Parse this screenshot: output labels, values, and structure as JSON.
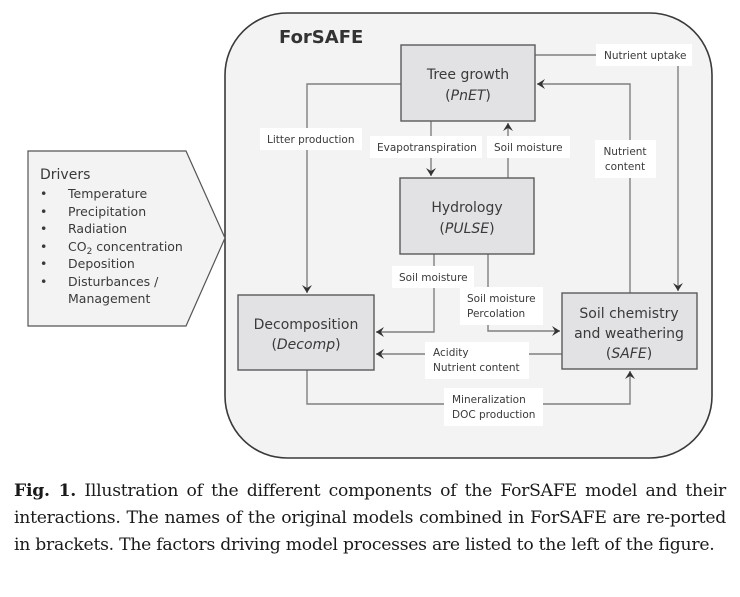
{
  "diagram": {
    "title": "ForSAFE",
    "colors": {
      "outer_fill": "#f3f3f3",
      "outer_stroke": "#3a3a3a",
      "box_fill": "#e2e2e4",
      "box_stroke": "#5a5a5a",
      "line": "#808080",
      "arrow": "#333333",
      "text": "#3a3a3a",
      "label_bg": "#ffffff",
      "drivers_fill": "#f3f3f3"
    },
    "boxes": {
      "tree_growth": {
        "name": "Tree growth",
        "model": "PnET"
      },
      "hydrology": {
        "name": "Hydrology",
        "model": "PULSE"
      },
      "decomposition": {
        "name": "Decomposition",
        "model": "Decomp"
      },
      "soil_chemistry": {
        "name_line1": "Soil chemistry",
        "name_line2": "and weathering",
        "model": "SAFE"
      }
    },
    "flows": {
      "nutrient_uptake": "Nutrient uptake",
      "litter_production": "Litter production",
      "evapotranspiration": "Evapotranspiration",
      "soil_moisture_up": "Soil moisture",
      "nutrient_content_line1": "Nutrient",
      "nutrient_content_line2": "content",
      "soil_moisture_decomp": "Soil moisture",
      "soil_moisture_safe": "Soil moisture",
      "percolation": "Percolation",
      "acidity": "Acidity",
      "nutrient_content_decomp": "Nutrient content",
      "mineralization": "Mineralization",
      "doc_production": "DOC production"
    },
    "drivers": {
      "title": "Drivers",
      "bullet": "•",
      "items": [
        {
          "text": "Temperature"
        },
        {
          "text": "Precipitation"
        },
        {
          "text": "Radiation"
        },
        {
          "text_pre": "CO",
          "text_sub": "2",
          "text_post": " concentration"
        },
        {
          "text": "Deposition"
        },
        {
          "text": "Disturbances /",
          "continuation": "Management"
        }
      ]
    }
  },
  "caption": {
    "label": "Fig. 1.",
    "text": " Illustration of the different components of the ForSAFE model and their interactions. The names of the original models combined in ForSAFE are re-ported in brackets. The factors driving model processes are listed to the left of the figure."
  }
}
